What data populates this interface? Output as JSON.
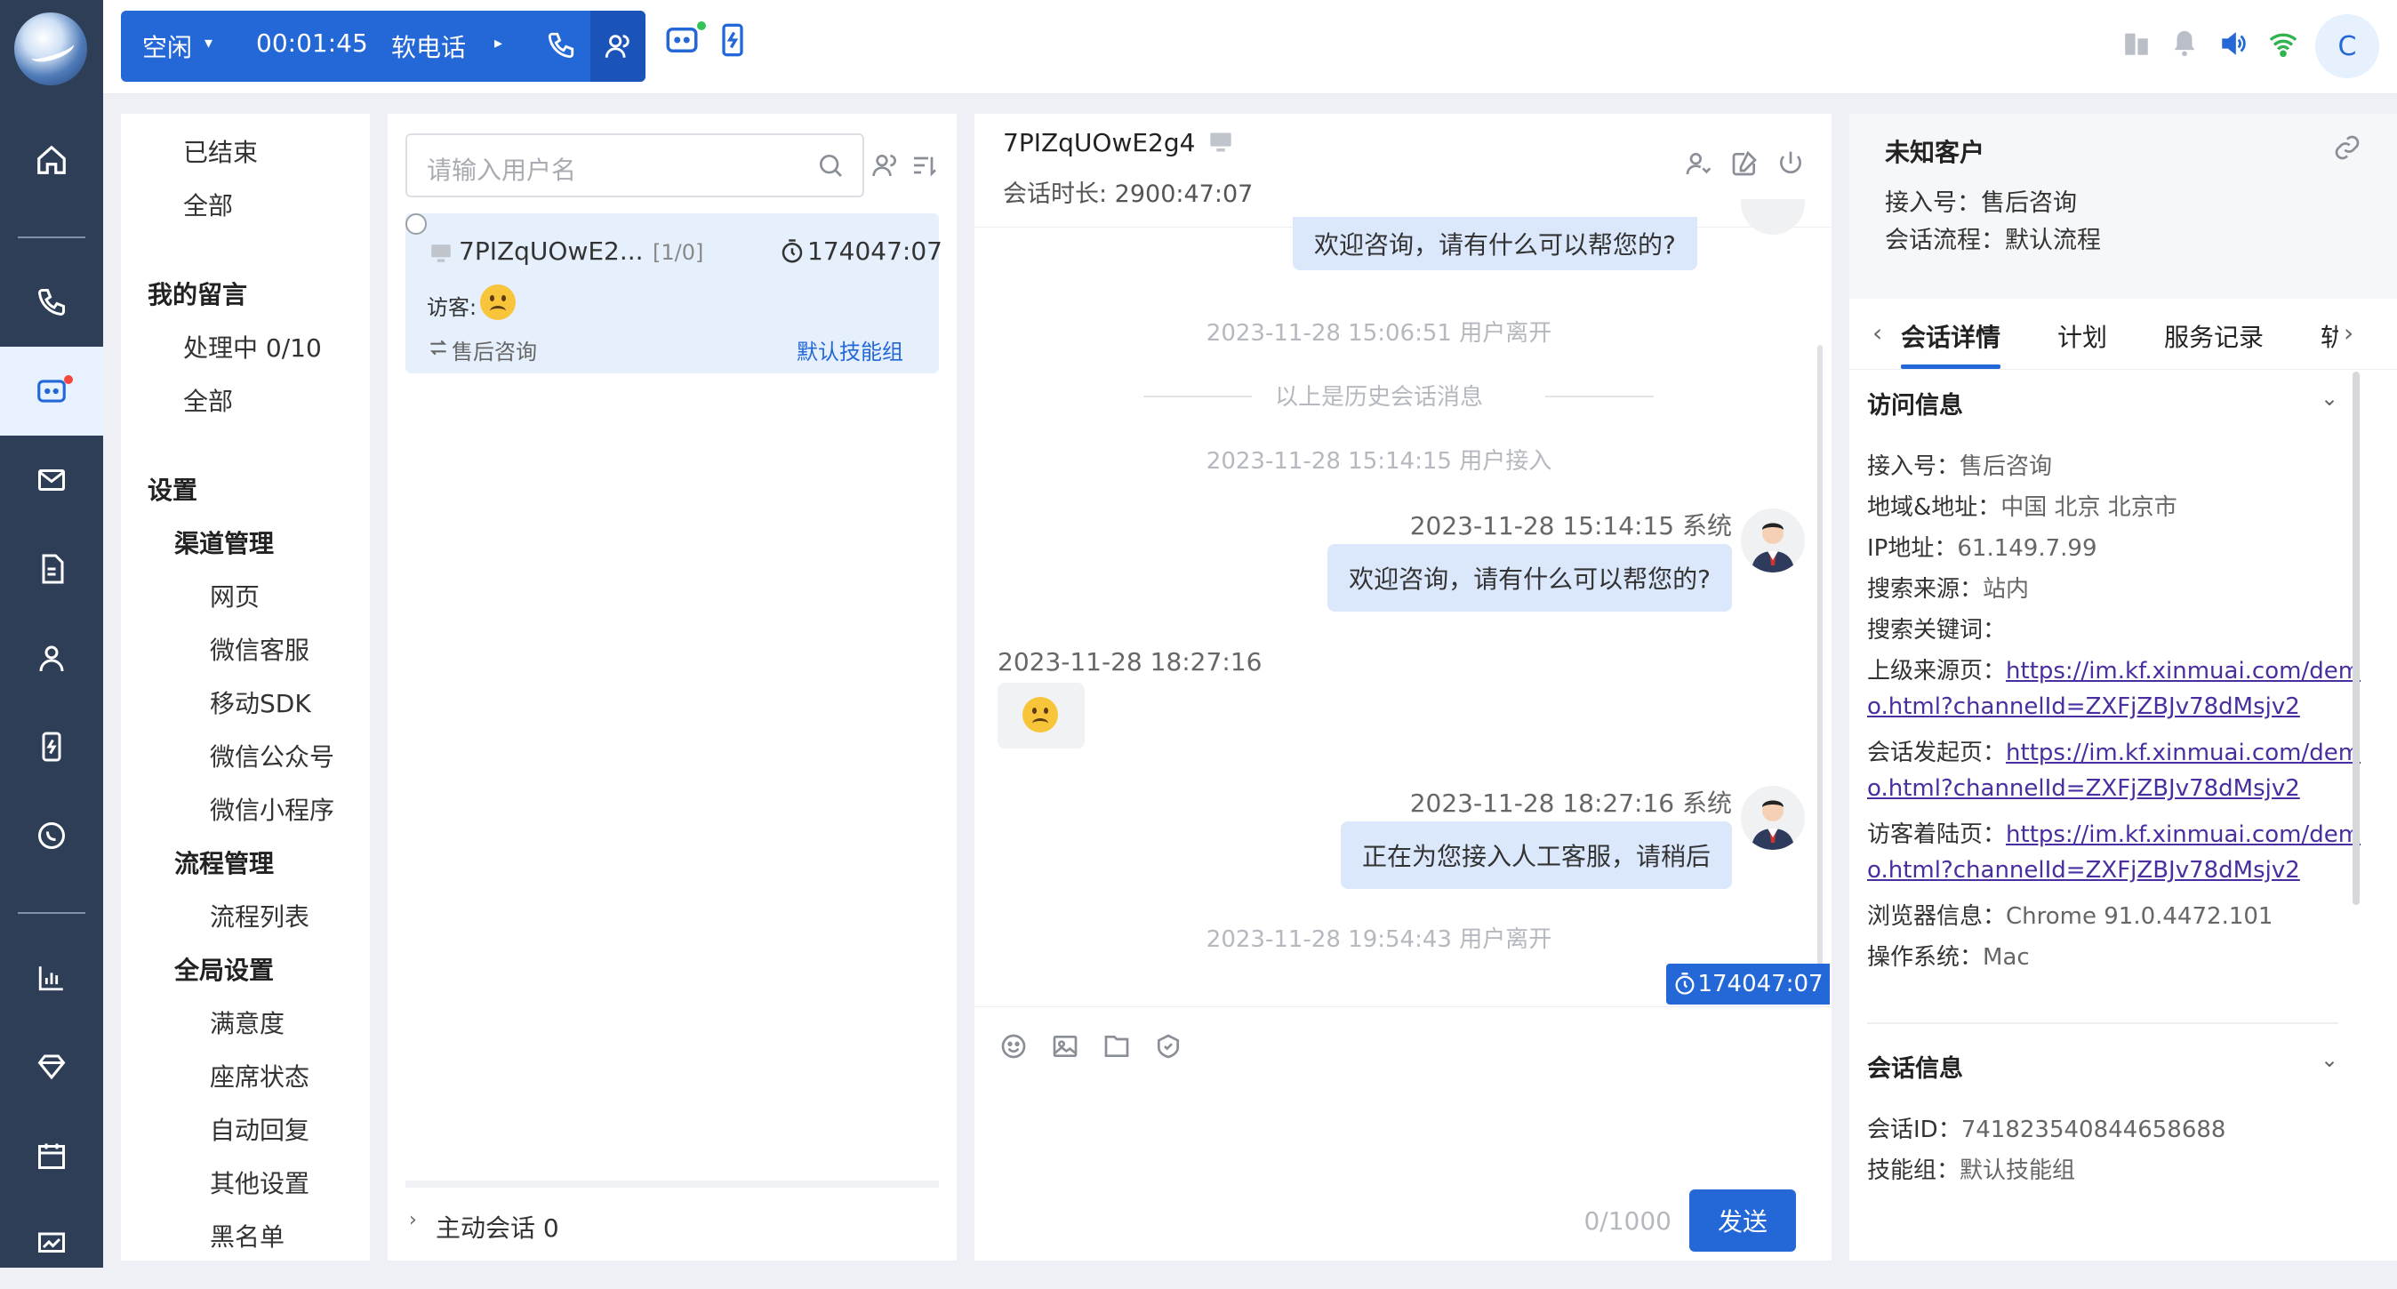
{
  "topbar": {
    "status": "空闲",
    "timer": "00:01:45",
    "softphone": "软电话",
    "user_initial": "C"
  },
  "col1": {
    "ended": "已结束",
    "all1": "全部",
    "my_messages": "我的留言",
    "processing": "处理中 0/10",
    "all2": "全部",
    "settings": "设置",
    "channel_mgmt": "渠道管理",
    "web": "网页",
    "wechat_cs": "微信客服",
    "mobile_sdk": "移动SDK",
    "wechat_oa": "微信公众号",
    "wechat_mini": "微信小程序",
    "flow_mgmt": "流程管理",
    "flow_list": "流程列表",
    "global_settings": "全局设置",
    "satisfaction": "满意度",
    "seat_status": "座席状态",
    "auto_reply": "自动回复",
    "other_settings": "其他设置",
    "blacklist": "黑名单"
  },
  "col2": {
    "search_placeholder": "请输入用户名",
    "conv_name": "7PIZqUOwE2...",
    "conv_count": "[1/0]",
    "conv_timer": "174047:07",
    "visitor_label": "访客:",
    "channel": "售后咨询",
    "skill_group": "默认技能组",
    "active_sessions": "主动会话 0"
  },
  "chat": {
    "title": "7PIZqUOwE2g4",
    "duration": "会话时长: 2900:47:07",
    "msg_top": "欢迎咨询，请有什么可以帮您的?",
    "sys1": "2023-11-28 15:06:51 用户离开",
    "history": "以上是历史会话消息",
    "sys2": "2023-11-28 15:14:15 用户接入",
    "meta1": "2023-11-28 15:14:15 系统",
    "msg1": "欢迎咨询，请有什么可以帮您的?",
    "visitor_time": "2023-11-28 18:27:16",
    "meta2": "2023-11-28 18:27:16 系统",
    "msg2": "正在为您接入人工客服，请稍后",
    "sys3": "2023-11-28 19:54:43 用户离开",
    "timer_tag": "174047:07",
    "counter": "0/1000",
    "send": "发送"
  },
  "customer": {
    "name": "未知客户",
    "access_no": "接入号：售后咨询",
    "flow": "会话流程：默认流程",
    "tabs": [
      "会话详情",
      "计划",
      "服务记录",
      "轨"
    ],
    "visit_title": "访问信息",
    "k_access": "接入号：",
    "v_access": "售后咨询",
    "k_region": "地域&地址：",
    "v_region": "中国 北京 北京市",
    "k_ip": "IP地址：",
    "v_ip": "61.149.7.99",
    "k_source": "搜索来源：",
    "v_source": "站内",
    "k_keyword": "搜索关键词：",
    "k_ref": "上级来源页：",
    "link1a": "https://im.kf.xinmuai.com/dem",
    "link1b": "o.html?channelId=ZXFjZBJv78dMsjv2",
    "k_start": "会话发起页：",
    "link2a": "https://im.kf.xinmuai.com/dem",
    "link2b": "o.html?channelId=ZXFjZBJv78dMsjv2",
    "k_landing": "访客着陆页：",
    "link3a": "https://im.kf.xinmuai.com/dem",
    "link3b": "o.html?channelId=ZXFjZBJv78dMsjv2",
    "k_browser": "浏览器信息：",
    "v_browser": "Chrome 91.0.4472.101",
    "k_os": "操作系统：",
    "v_os": "Mac",
    "session_title": "会话信息",
    "k_sid": "会话ID：",
    "v_sid": "741823540844658688",
    "k_skill": "技能组：",
    "v_skill": "默认技能组"
  },
  "colors": {
    "primary": "#2468d8",
    "nav_bg": "#2f3e57",
    "bubble": "#dbe8fc"
  }
}
